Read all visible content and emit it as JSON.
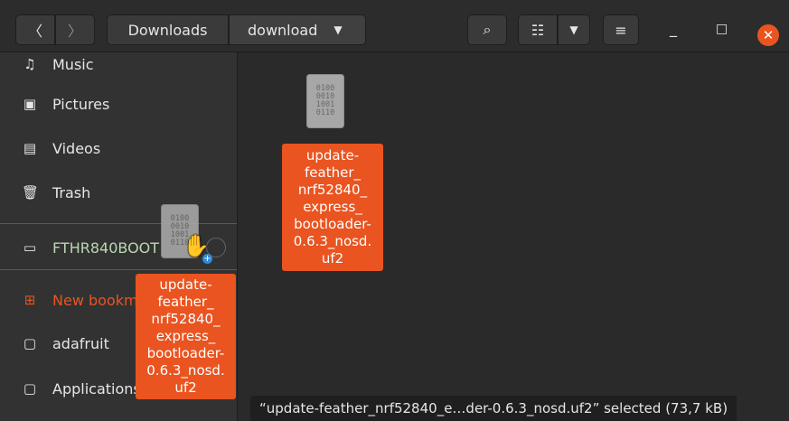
{
  "header": {
    "back_icon": "〈",
    "forward_icon": "〉",
    "breadcrumbs": [
      "Downloads",
      "download"
    ],
    "dropdown_caret": "▼",
    "search_icon": "⌕",
    "view_icon": "☷",
    "view_menu_caret": "▼",
    "menu_icon": "≡",
    "minimize_icon": "_",
    "maximize_icon": "□",
    "close_icon": "✕"
  },
  "sidebar": {
    "items": [
      {
        "label": "Music",
        "icon": "♫"
      },
      {
        "label": "Pictures",
        "icon": "▣"
      },
      {
        "label": "Videos",
        "icon": "▤"
      },
      {
        "label": "Trash",
        "icon": "🗑"
      },
      {
        "label": "FTHR840BOOT",
        "icon": "▭"
      },
      {
        "label": "New bookmark",
        "icon": "⊞"
      },
      {
        "label": "adafruit",
        "icon": "▢"
      },
      {
        "label": "Applications",
        "icon": "▢"
      }
    ]
  },
  "files": [
    {
      "name_lines": [
        "update-",
        "feather_",
        "nrf52840_",
        "express_",
        "bootloader-",
        "0.6.3_nosd.",
        "uf2"
      ],
      "icon_text": "0100\n0010\n1001\n0110"
    }
  ],
  "drag_ghost": {
    "name_lines": [
      "update-",
      "feather_",
      "nrf52840_",
      "express_",
      "bootloader-",
      "0.6.3_nosd.",
      "uf2"
    ],
    "icon_text": "0100\n0010\n1001\n0110",
    "cursor_icon": "✋",
    "copy_badge": "+"
  },
  "status_bar": {
    "text": "“update-feather_nrf52840_e…der-0.6.3_nosd.uf2” selected  (73,7 kB)"
  },
  "colors": {
    "accent": "#e95420",
    "background": "#2a2a2a",
    "sidebar": "#323232"
  }
}
